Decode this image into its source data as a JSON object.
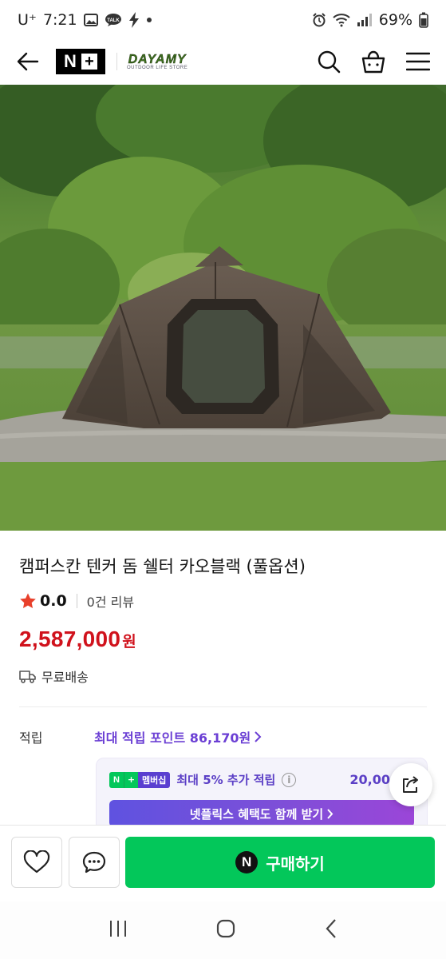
{
  "status_bar": {
    "carrier": "U⁺",
    "time": "7:21",
    "battery": "69%",
    "icons": [
      "image-icon",
      "talk-icon",
      "bolt-icon",
      "dot-icon",
      "alarm-icon",
      "wifi-icon",
      "signal-icon",
      "battery-icon"
    ]
  },
  "header": {
    "back_icon": "arrow-left-icon",
    "nplus_logo": "N+",
    "store_name": "DAYAMY",
    "store_tagline": "OUTDOOR LIFE STORE",
    "search_icon": "search-icon",
    "cart_icon": "shopping-bag-icon",
    "menu_icon": "hamburger-menu-icon"
  },
  "product": {
    "title": "캠퍼스칸 텐커 돔 쉘터 카오블랙 (풀옵션)",
    "rating": "0.0",
    "review_count": "0건 리뷰",
    "price": "2,587,000",
    "price_unit": "원",
    "shipping": "무료배송"
  },
  "points": {
    "label": "적립",
    "link_text": "최대 적립 포인트 86,170원",
    "membership_badge": "멤버십",
    "membership_text": "최대 5% 추가 적립",
    "membership_amount": "20,00",
    "netflix_button": "넷플릭스 혜택도 함께 받기"
  },
  "actions": {
    "buy_label": "구매하기",
    "buy_logo": "N"
  },
  "colors": {
    "price_red": "#d0121c",
    "naver_green": "#03c75a",
    "points_purple": "#6b3fd4"
  }
}
